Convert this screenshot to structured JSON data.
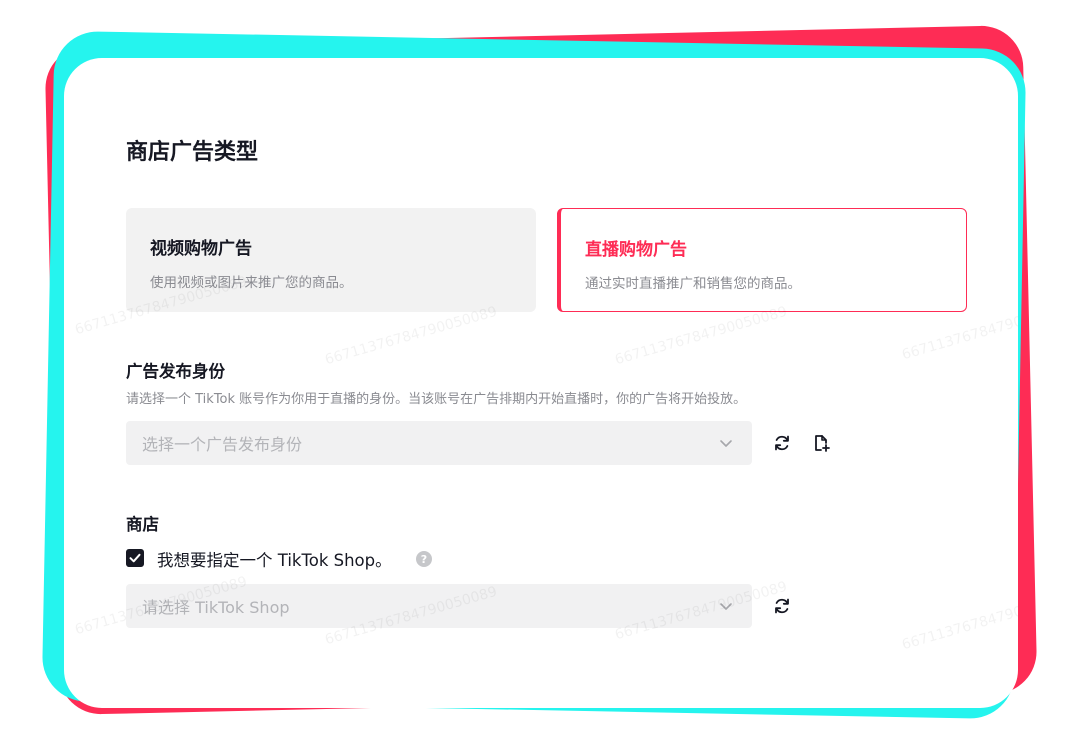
{
  "header": {
    "title": "商店广告类型"
  },
  "ad_types": [
    {
      "title": "视频购物广告",
      "desc": "使用视频或图片来推广您的商品。",
      "selected": false
    },
    {
      "title": "直播购物广告",
      "desc": "通过实时直播推广和销售您的商品。",
      "selected": true
    }
  ],
  "identity": {
    "label": "广告发布身份",
    "hint": "请选择一个 TikTok 账号作为你用于直播的身份。当该账号在广告排期内开始直播时，你的广告将开始投放。",
    "placeholder": "选择一个广告发布身份"
  },
  "shop": {
    "label": "商店",
    "checkbox_label": "我想要指定一个 TikTok Shop。",
    "checked": true,
    "help": "?",
    "placeholder": "请选择 TikTok Shop"
  },
  "watermark": "66711376784790050089",
  "colors": {
    "accent": "#fe2c55",
    "cyan": "#25f4ee",
    "text": "#161823",
    "muted": "#8a8b91"
  },
  "icons": [
    "refresh-icon",
    "add-document-icon",
    "chevron-down-icon",
    "check-icon",
    "question-icon"
  ]
}
